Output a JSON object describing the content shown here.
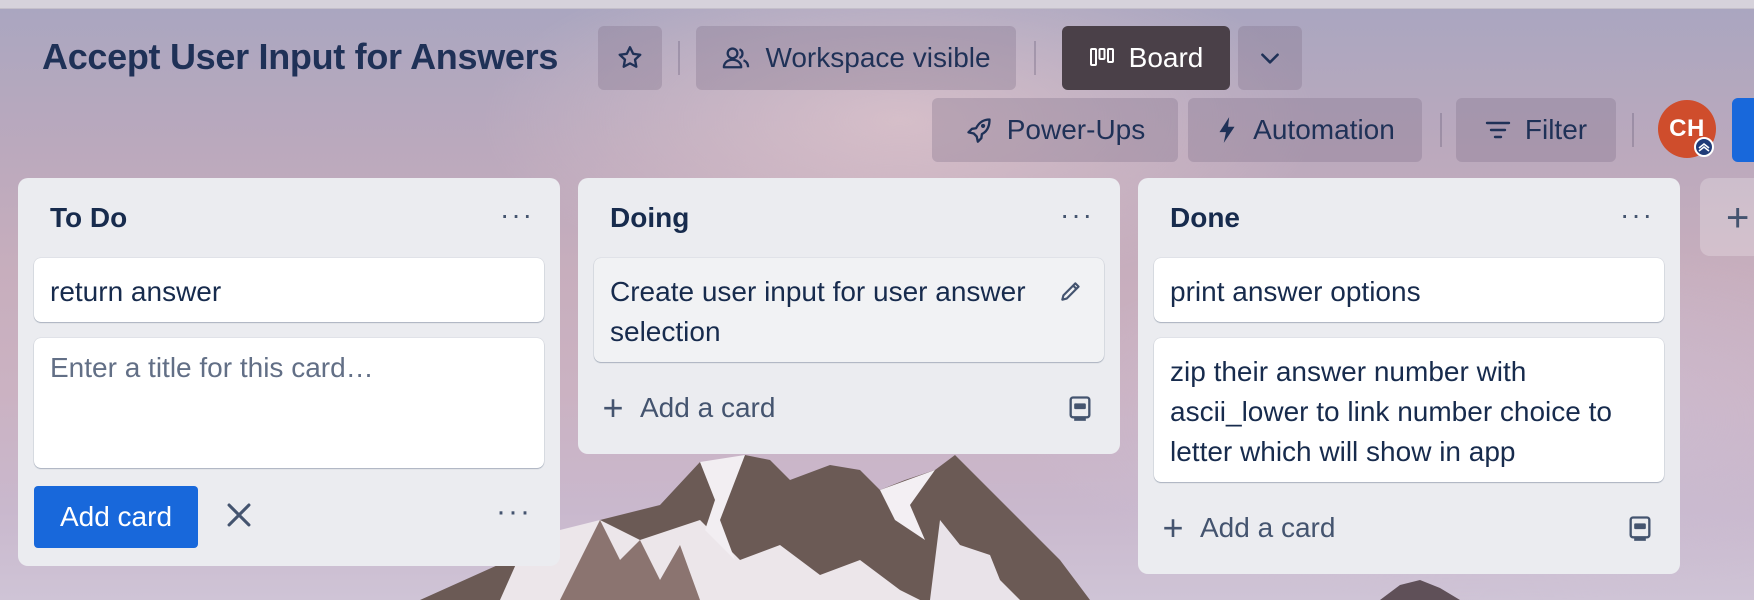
{
  "board": {
    "title": "Accept User Input for Answers",
    "visibility_label": "Workspace visible",
    "view_label": "Board",
    "powerups_label": "Power-Ups",
    "automation_label": "Automation",
    "filter_label": "Filter",
    "avatar_initials": "CH"
  },
  "lists": [
    {
      "title": "To Do",
      "cards": [
        "return answer"
      ],
      "composer_placeholder": "Enter a title for this card…",
      "add_card_button": "Add card"
    },
    {
      "title": "Doing",
      "cards": [
        "Create user input for user answer selection"
      ],
      "add_card_label": "Add a card"
    },
    {
      "title": "Done",
      "cards": [
        "print answer options",
        "zip their answer number with ascii_lower to link number choice to letter which will show in app"
      ],
      "add_card_label": "Add a card"
    }
  ],
  "colors": {
    "primary": "#1868db",
    "list_bg": "#ebecf0",
    "text": "#172b4d",
    "avatar": "#cf4d2c"
  }
}
